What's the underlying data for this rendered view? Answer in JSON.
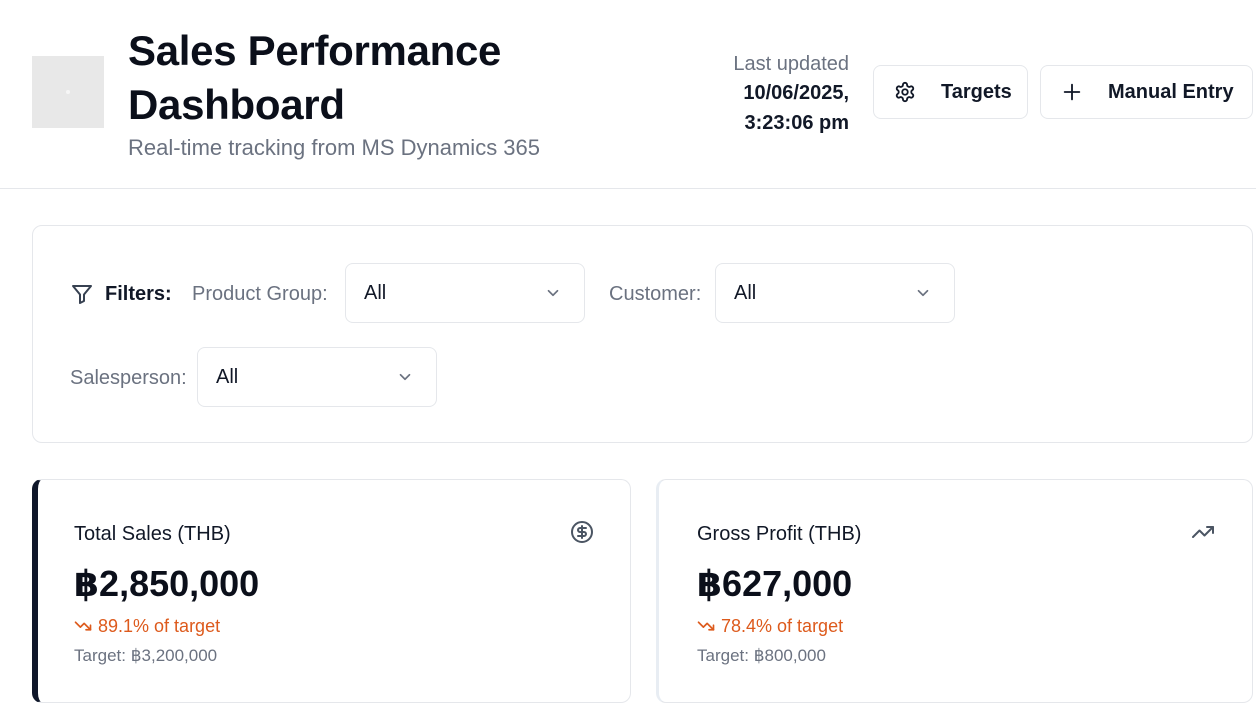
{
  "header": {
    "title": "Sales Performance Dashboard",
    "subtitle": "Real-time tracking from MS Dynamics 365",
    "last_updated_label": "Last updated",
    "last_updated_value": "10/06/2025, 3:23:06 pm",
    "targets_button": "Targets",
    "manual_entry_button": "Manual Entry",
    "icons": {
      "targets": "gear-icon",
      "manual_entry": "plus-icon",
      "logo": "logo-placeholder"
    }
  },
  "filters": {
    "title": "Filters:",
    "icon": "filter-icon",
    "product_group": {
      "label": "Product Group:",
      "value": "All"
    },
    "customer": {
      "label": "Customer:",
      "value": "All"
    },
    "salesperson": {
      "label": "Salesperson:",
      "value": "All"
    }
  },
  "kpis": [
    {
      "title": "Total Sales (THB)",
      "value": "฿2,850,000",
      "trend": "89.1% of target",
      "target": "Target: ฿3,200,000",
      "icon": "dollar-circle-icon",
      "accent": "#0f172a"
    },
    {
      "title": "Gross Profit (THB)",
      "value": "฿627,000",
      "trend": "78.4% of target",
      "target": "Target: ฿800,000",
      "icon": "trending-up-icon",
      "accent": "#e8edf3"
    }
  ],
  "colors": {
    "trend_down": "#dd5a1c",
    "muted_text": "#6b7280",
    "border": "#e5e7eb"
  }
}
